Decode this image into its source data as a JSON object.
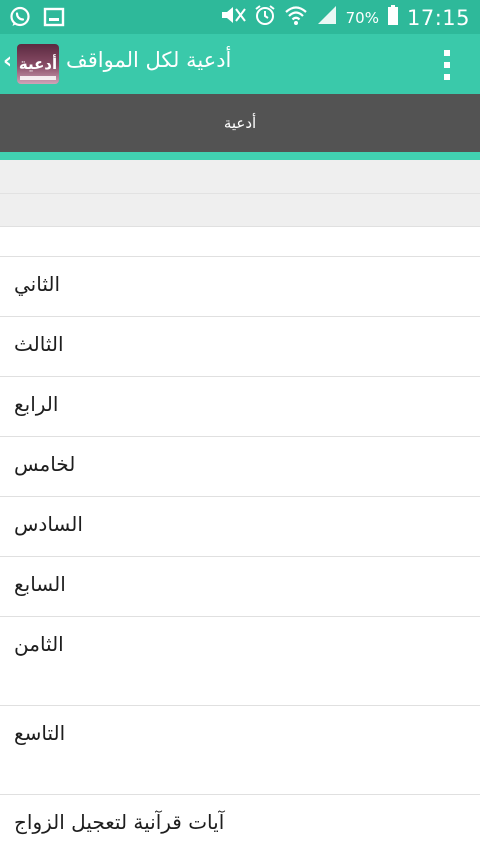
{
  "status_bar": {
    "left_icons": [
      "whatsapp-icon",
      "gallery-icon"
    ],
    "right_icons": [
      "mute-icon",
      "alarm-icon",
      "wifi-icon",
      "signal-icon"
    ],
    "battery": "70%",
    "time": "17:15"
  },
  "app_bar": {
    "back_glyph": "‹",
    "icon_label": "أدعية",
    "title": "أدعية لكل المواقف"
  },
  "tab": {
    "label": "أدعية"
  },
  "list": {
    "items": [
      {
        "label": ""
      },
      {
        "label": "الثاني"
      },
      {
        "label": "الثالث"
      },
      {
        "label": "الرابع"
      },
      {
        "label": "لخامس"
      },
      {
        "label": "السادس"
      },
      {
        "label": "السابع"
      },
      {
        "label": "الثامن"
      },
      {
        "label": "التاسع"
      },
      {
        "label": "آيات قرآنية لتعجيل الزواج"
      }
    ]
  },
  "colors": {
    "status_bar": "#2eb99a",
    "app_bar": "#3ac9aa",
    "tab_bar": "#535353",
    "tab_indicator": "#41d1b1"
  }
}
